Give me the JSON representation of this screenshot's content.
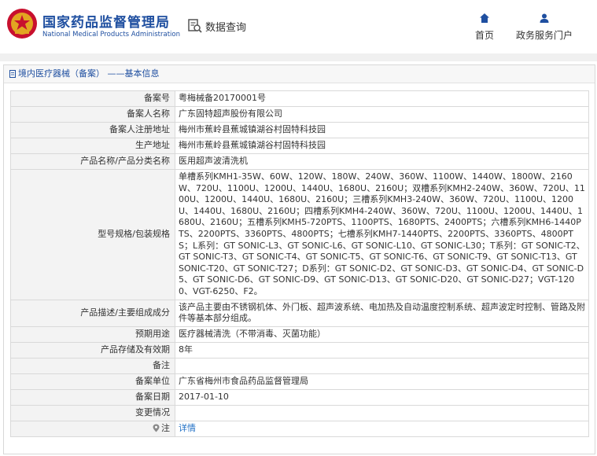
{
  "header": {
    "brand_cn": "国家药品监督管理局",
    "brand_en": "National Medical Products Administration",
    "search_label": "数据查询",
    "nav_home": "首页",
    "nav_portal": "政务服务门户"
  },
  "breadcrumb": "境内医疗器械（备案） ——基本信息",
  "rows": [
    {
      "label": "备案号",
      "value": "粤梅械备20170001号"
    },
    {
      "label": "备案人名称",
      "value": "广东固特超声股份有限公司"
    },
    {
      "label": "备案人注册地址",
      "value": "梅州市蕉岭县蕉城镇湖谷村固特科技园"
    },
    {
      "label": "生产地址",
      "value": "梅州市蕉岭县蕉城镇湖谷村固特科技园"
    },
    {
      "label": "产品名称/产品分类名称",
      "value": "医用超声波清洗机"
    },
    {
      "label": "型号规格/包装规格",
      "value": "单槽系列KMH1-35W、60W、120W、180W、240W、360W、1100W、1440W、1800W、2160W、720U、1100U、1200U、1440U、1680U、2160U；双槽系列KMH2-240W、360W、720U、1100U、1200U、1440U、1680U、2160U；三槽系列KMH3-240W、360W、720U、1100U、1200U、1440U、1680U、2160U；四槽系列KMH4-240W、360W、720U、1100U、1200U、1440U、1680U、2160U；五槽系列KMH5-720PTS、1100PTS、1680PTS、2400PTS；六槽系列KMH6-1440PTS、2200PTS、3360PTS、4800PTS；七槽系列KMH7-1440PTS、2200PTS、3360PTS、4800PTS；L系列：GT SONIC-L3、GT SONIC-L6、GT SONIC-L10、GT SONIC-L30；T系列：GT SONIC-T2、GT SONIC-T3、GT SONIC-T4、GT SONIC-T5、GT SONIC-T6、GT SONIC-T9、GT SONIC-T13、GT SONIC-T20、GT SONIC-T27；D系列：GT SONIC-D2、GT SONIC-D3、GT SONIC-D4、GT SONIC-D5、GT SONIC-D6、GT SONIC-D9、GT SONIC-D13、GT SONIC-D20、GT SONIC-D27；VGT-1200、VGT-6250、F2。"
    },
    {
      "label": "产品描述/主要组成成分",
      "value": "该产品主要由不锈钢机体、外门板、超声波系统、电加热及自动温度控制系统、超声波定时控制、管路及附件等基本部分组成。"
    },
    {
      "label": "预期用途",
      "value": "医疗器械清洗（不带消毒、灭菌功能）"
    },
    {
      "label": "产品存储及有效期",
      "value": "8年"
    },
    {
      "label": "备注",
      "value": ""
    },
    {
      "label": "备案单位",
      "value": "广东省梅州市食品药品监督管理局"
    },
    {
      "label": "备案日期",
      "value": "2017-01-10"
    },
    {
      "label": "变更情况",
      "value": ""
    }
  ],
  "note_row": {
    "label": "注",
    "link": "详情"
  },
  "colors": {
    "brand_blue": "#1f4fa0",
    "link_blue": "#1f6fc5",
    "label_bg": "#f3f3f3"
  }
}
